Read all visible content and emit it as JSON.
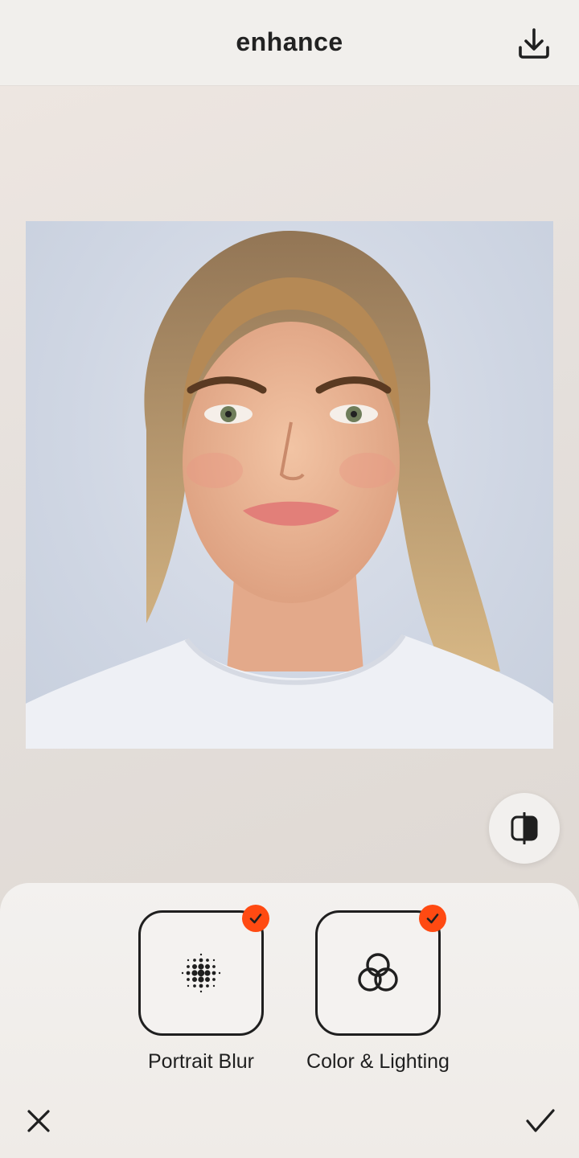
{
  "header": {
    "title": "enhance",
    "download_icon": "download-icon"
  },
  "preview": {
    "image_description_icon": "portrait-photo",
    "compare_icon": "compare-split-icon"
  },
  "tools": [
    {
      "label": "Portrait Blur",
      "icon": "halftone-dots-icon",
      "selected": true
    },
    {
      "label": "Color & Lighting",
      "icon": "interlocking-circles-icon",
      "selected": true
    }
  ],
  "footer": {
    "close_icon": "close-icon",
    "confirm_icon": "checkmark-icon"
  },
  "colors": {
    "accent": "#ff4a12",
    "outline": "#1f1f1f",
    "panel": "#f3f1ef"
  }
}
